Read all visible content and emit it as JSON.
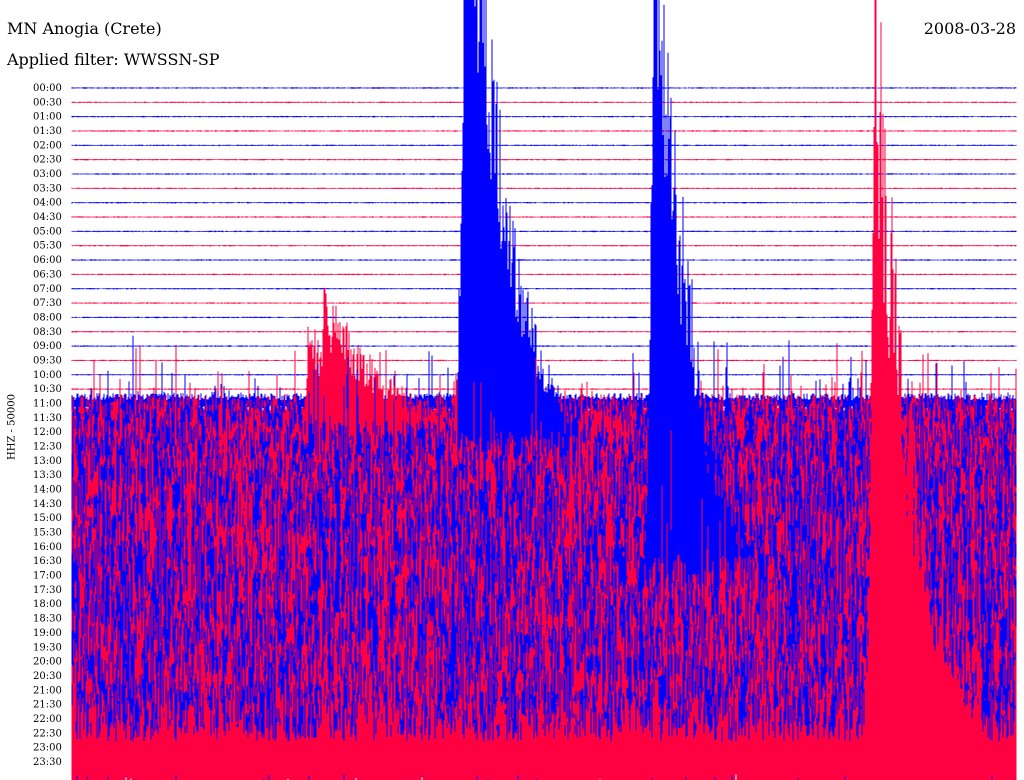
{
  "header": {
    "station": "MN Anogia (Crete)",
    "date": "2008-03-28",
    "filter": "Applied filter: WWSSN-SP",
    "channel": "HHZ - 50000"
  },
  "colors": {
    "background": "#ffffff",
    "trace_even": "#0000ff",
    "trace_odd": "#ff0040",
    "text": "#000000"
  },
  "chart_data": {
    "type": "helicorder",
    "row_interval_minutes": 30,
    "y_tick_labels": [
      "00:00",
      "00:30",
      "01:00",
      "01:30",
      "02:00",
      "02:30",
      "03:00",
      "03:30",
      "04:00",
      "04:30",
      "05:00",
      "05:30",
      "06:00",
      "06:30",
      "07:00",
      "07:30",
      "08:00",
      "08:30",
      "09:00",
      "09:30",
      "10:00",
      "10:30",
      "11:00",
      "11:30",
      "12:00",
      "12:30",
      "13:00",
      "13:30",
      "14:00",
      "14:30",
      "15:00",
      "15:30",
      "16:00",
      "16:30",
      "17:00",
      "17:30",
      "18:00",
      "18:30",
      "19:00",
      "19:30",
      "20:00",
      "20:30",
      "21:00",
      "21:30",
      "22:00",
      "22:30",
      "23:00",
      "23:30"
    ],
    "trace_colors": [
      "blue",
      "red"
    ],
    "events": [
      {
        "row": "12:30",
        "minute_offset": 7.5,
        "relative_amplitude": 0.35,
        "color": "red"
      },
      {
        "row": "12:30",
        "minute_offset": 8.0,
        "relative_amplitude": 0.45,
        "color": "blue"
      },
      {
        "row": "13:00",
        "minute_offset": 12.5,
        "relative_amplitude": 1.0,
        "color": "red"
      },
      {
        "row": "18:00",
        "minute_offset": 18.5,
        "relative_amplitude": 1.0,
        "color": "red"
      },
      {
        "row": "23:30",
        "minute_offset": 25.5,
        "relative_amplitude": 1.0,
        "color": "red"
      }
    ]
  }
}
